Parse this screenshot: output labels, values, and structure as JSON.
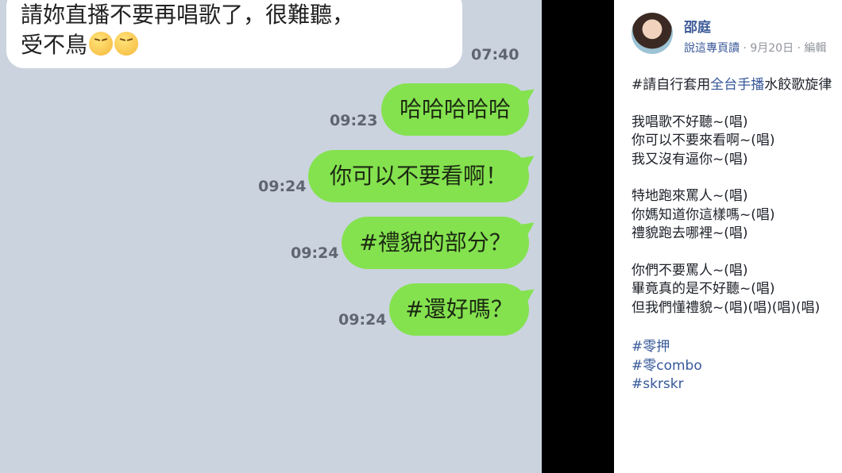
{
  "chat": {
    "incoming": {
      "line1": "請妳直播不要再唱歌了，很難聽，",
      "line2": "受不鳥",
      "emoji_names": [
        "steam-from-nose-face-icon",
        "steam-from-nose-face-icon"
      ],
      "time": "07:40"
    },
    "outgoing": [
      {
        "text": "哈哈哈哈哈",
        "time": "09:23"
      },
      {
        "text": "你可以不要看啊！",
        "time": "09:24"
      },
      {
        "text": "#禮貌的部分？",
        "time": "09:24"
      },
      {
        "text": "#還好嗎？",
        "time": "09:24"
      }
    ]
  },
  "post": {
    "author": "邵庭",
    "meta_link": "說這專頁讀",
    "meta_rest": "· 9月20日 · 編輯",
    "line1_pre": "#請自行套用",
    "line1_link": "全台手播",
    "line1_post": "水餃歌旋律",
    "stanza1": [
      "我唱歌不好聽~(唱)",
      "你可以不要來看啊~(唱)",
      "我又沒有逼你~(唱)"
    ],
    "stanza2": [
      "特地跑來罵人~(唱)",
      "你媽知道你這樣嗎~(唱)",
      "禮貌跑去哪裡~(唱)"
    ],
    "stanza3": [
      "你們不要罵人~(唱)",
      "畢竟真的是不好聽~(唱)",
      "但我們懂禮貌~(唱)(唱)(唱)(唱)"
    ],
    "hashtags": [
      "#零押",
      "#零combo",
      "#skrskr"
    ]
  },
  "colors": {
    "chat_bg": "#cbd3df",
    "bubble_green": "#84e24f",
    "fb_blue": "#365899"
  }
}
